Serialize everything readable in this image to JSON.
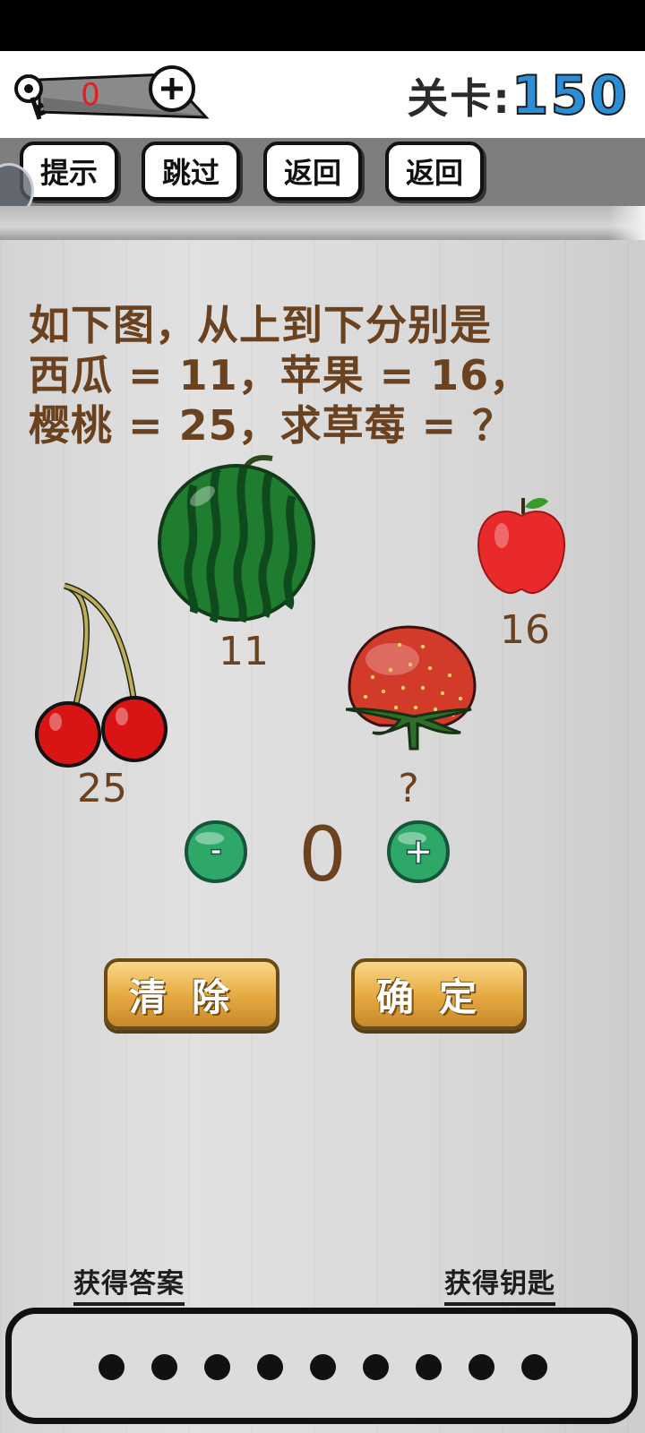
{
  "header": {
    "key_count": "0",
    "level_label": "关卡:",
    "level_number": "150"
  },
  "toolbar": {
    "buttons": [
      "提示",
      "跳过",
      "返回",
      "返回"
    ]
  },
  "question": {
    "lines": [
      "如下图，从上到下分别是",
      "西瓜 = 11，苹果 = 16，",
      "樱桃 = 25，求草莓 = ？"
    ]
  },
  "fruits": {
    "watermelon_value": "11",
    "apple_value": "16",
    "cherry_value": "25",
    "strawberry_value": "?"
  },
  "answer": {
    "minus_label": "-",
    "plus_label": "+",
    "value": "0"
  },
  "actions": {
    "clear_label": "清除",
    "confirm_label": "确定"
  },
  "links": {
    "get_answer": "获得答案",
    "get_key": "获得钥匙"
  },
  "answer_slots": 9,
  "colors": {
    "level_number": "#2a8fd6",
    "question_text": "#6b4220",
    "key_count": "#e02020",
    "control_green": "#2ea868"
  }
}
